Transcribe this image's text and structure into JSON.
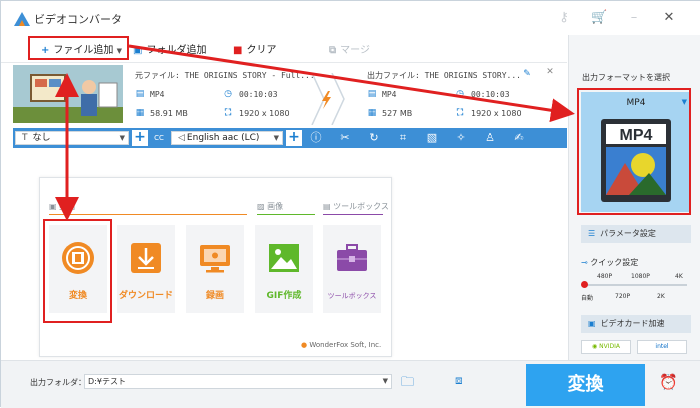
{
  "app": {
    "title": "ビデオコンバータ"
  },
  "toolbar": {
    "add_file": "ファイル追加",
    "add_folder": "フォルダ追加",
    "clear": "クリア",
    "merge": "マージ"
  },
  "file": {
    "source_label": "元ファイル: THE ORIGINS STORY - Full...",
    "source_format": "MP4",
    "source_duration": "00:10:03",
    "source_size": "58.91 MB",
    "source_resolution": "1920 x 1080",
    "output_label": "出力ファイル: THE ORIGINS STORY...",
    "output_format": "MP4",
    "output_duration": "00:10:03",
    "output_size": "527 MB",
    "output_resolution": "1920 x 1080"
  },
  "editbar": {
    "subtitle": "なし",
    "cc": "CC",
    "audio": "English aac (LC)"
  },
  "tools": {
    "sections": {
      "video": "動画",
      "image": "画像",
      "toolbox": "ツールボックス"
    },
    "items": [
      {
        "label": "変換",
        "color": "#f08a24"
      },
      {
        "label": "ダウンロード",
        "color": "#f08a24"
      },
      {
        "label": "録画",
        "color": "#f08a24"
      },
      {
        "label": "GIF作成",
        "color": "#5fb82b"
      },
      {
        "label": "ツールボックス",
        "color": "#8b4aa8"
      }
    ],
    "credit": "WonderFox Soft, Inc."
  },
  "right": {
    "heading": "出力フォーマットを選択",
    "format": "MP4",
    "param_button": "パラメータ設定",
    "quick_label": "クイック設定",
    "quality_top": [
      "480P",
      "1080P",
      "4K"
    ],
    "quality_bottom": [
      "自動",
      "720P",
      "2K"
    ],
    "gpu_label": "ビデオカード加速",
    "nvidia": "NVIDIA",
    "intel": "intel"
  },
  "bottom": {
    "folder_label": "出力フォルダ：",
    "folder_value": "D:¥テスト",
    "convert": "変換"
  },
  "colors": {
    "accent": "#3d8fd6",
    "convert_button": "#2ea3f0",
    "highlight": "#e02020"
  }
}
